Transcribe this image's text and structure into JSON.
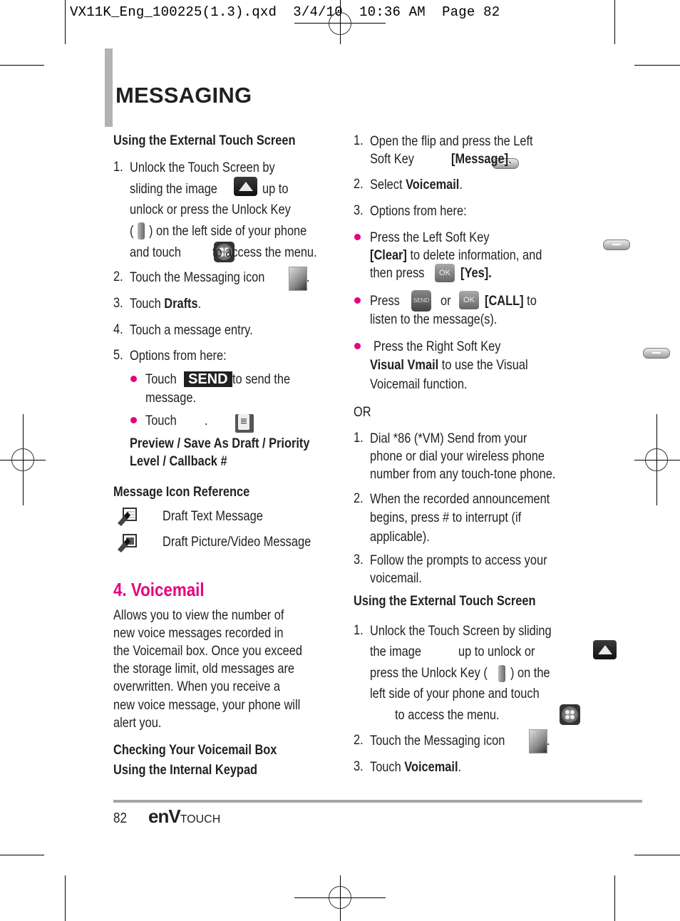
{
  "slug": "VX11K_Eng_100225(1.3).qxd  3/4/10  10:36 AM  Page 82",
  "page_title": "MESSAGING",
  "left": {
    "drafts_heading": "Using the External Touch Screen",
    "steps": [
      {
        "num": "1.",
        "lines": [
          "Unlock the Touch Screen by",
          "sliding the image",
          "up to",
          "unlock or press the Unlock Key",
          "(",
          ") on the left side of your phone",
          "and touch",
          "to access the menu."
        ]
      },
      {
        "num": "2.",
        "text": "Touch the Messaging icon",
        "suffix": "."
      },
      {
        "num": "3.",
        "text": "Touch ",
        "bold": "Drafts",
        "suffix": "."
      },
      {
        "num": "4.",
        "text": "Touch a message entry."
      },
      {
        "num": "5.",
        "text": "Options from here:"
      }
    ],
    "bullets": [
      {
        "pre": "Touch",
        "tag": "SEND",
        "post": "to send the",
        "line2": "message."
      },
      {
        "pre": "Touch",
        "post": "."
      }
    ],
    "options_bold": [
      "Preview / Save As Draft / Priority",
      "Level / Callback #"
    ],
    "icon_ref_heading": "Message Icon Reference",
    "icon_ref": [
      {
        "icon": "draft-text-message-icon",
        "label": "Draft Text Message"
      },
      {
        "icon": "draft-picture-video-message-icon",
        "label": "Draft Picture/Video Message"
      }
    ],
    "section_title": "4. Voicemail",
    "description": [
      "Allows you to view the number of",
      "new voice messages recorded in",
      "the Voicemail box. Once you exceed",
      "the storage limit, old messages are",
      "overwritten. When you receive a",
      "new voice message, your phone will",
      "alert you."
    ],
    "checking_heading": [
      "Checking Your Voicemail Box",
      "Using the Internal Keypad"
    ]
  },
  "right": {
    "steps_a": [
      {
        "num": "1.",
        "line1": "Open the flip and press the Left",
        "line2_pre": "Soft Key",
        "line2_bold": "[Message]",
        "line2_post": "."
      },
      {
        "num": "2.",
        "pre": "Select ",
        "bold": "Voicemail",
        "post": "."
      },
      {
        "num": "3.",
        "text": "Options from here:"
      }
    ],
    "bullets": [
      {
        "line1": "Press the Left Soft Key",
        "line2_bold": "[Clear]",
        "line2": " to delete information, and",
        "line3_pre": "then press",
        "line3_bold": "[Yes]."
      },
      {
        "pre": "Press",
        "mid": "or",
        "bold": "[CALL]",
        "post": " to",
        "line2": "listen to the message(s)."
      },
      {
        "line1": "Press the Right Soft Key",
        "line2_bold": "Visual Vmail",
        "line2": " to use the Visual",
        "line3": "Voicemail function."
      }
    ],
    "or_label": "OR",
    "steps_b": [
      {
        "num": "1.",
        "lines": [
          "Dial *86 (*VM) Send from your",
          "phone or dial your wireless phone",
          "number from any touch-tone phone."
        ]
      },
      {
        "num": "2.",
        "lines": [
          "When the recorded announcement",
          "begins, press # to interrupt (if",
          "applicable)."
        ]
      },
      {
        "num": "3.",
        "lines": [
          "Follow the prompts to access your",
          "voicemail."
        ]
      }
    ],
    "ext_heading": "Using the External Touch Screen",
    "steps_c": [
      {
        "num": "1.",
        "lines": [
          "Unlock the Touch Screen by sliding",
          "the image",
          "up to unlock or",
          "press the Unlock Key (",
          ") on the",
          "left side of your phone and touch",
          "to access the menu."
        ]
      },
      {
        "num": "2.",
        "text": "Touch the Messaging icon",
        "suffix": "."
      },
      {
        "num": "3.",
        "pre": "Touch ",
        "bold": "Voicemail",
        "post": "."
      }
    ]
  },
  "footer": {
    "page_number": "82",
    "brand": "enV",
    "brand_suffix": "TOUCH"
  },
  "colors": {
    "accent": "#e6007e",
    "text": "#231f20",
    "title_bar": "#b3b3b3",
    "rule": "#a6a6a6"
  }
}
